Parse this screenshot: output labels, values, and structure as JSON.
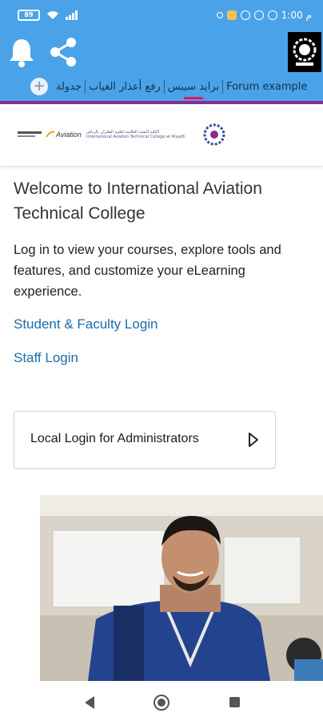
{
  "status_bar": {
    "battery": "89",
    "time": "1:00 م"
  },
  "app_bar": {
    "icons": [
      "bell-icon",
      "share-icon",
      "institution-logo-icon"
    ],
    "tabs": [
      {
        "label": "جدولة",
        "active": false
      },
      {
        "label": "رفع أعذار الغياب",
        "active": false
      },
      {
        "label": "برايد سيبس",
        "active": true
      },
      {
        "label": "Forum example",
        "active": false
      }
    ],
    "add_symbol": "+",
    "accent_color": "#e4185c",
    "bar_color": "#4aa3e8",
    "divider_color": "#8b2a8f"
  },
  "college_header": {
    "logo_text_ar": "الكلية التقنية العالمية لعلوم الطيران بالرياض",
    "logo_text_en": "International Aviation Technical College at Riyadh",
    "partner_logo_text": "Aviation"
  },
  "content": {
    "welcome_title": "Welcome to International Aviation Technical College",
    "intro_text": "Log in to view your courses, explore tools and features, and customize your eLearning experience.",
    "student_login": "Student & Faculty Login",
    "staff_login": "Staff Login",
    "local_login": "Local Login for Administrators",
    "link_color": "#1a6ea8"
  },
  "nav": {
    "icons": [
      "back-icon",
      "home-icon",
      "recent-apps-icon"
    ]
  }
}
